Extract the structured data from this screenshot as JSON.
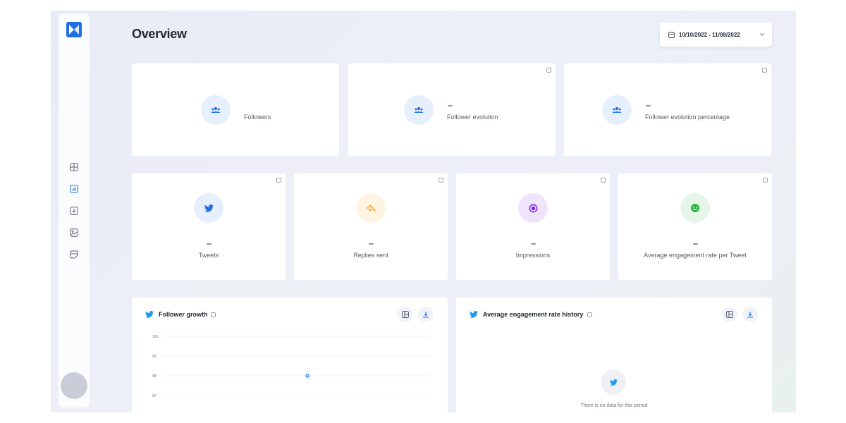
{
  "header": {
    "title": "Overview",
    "date_range": "10/10/2022 - 11/08/2022"
  },
  "sidebar": {
    "items": [
      {
        "icon": "layout-icon"
      },
      {
        "icon": "analytics-icon"
      },
      {
        "icon": "download-icon"
      },
      {
        "icon": "image-icon"
      },
      {
        "icon": "message-icon"
      }
    ]
  },
  "top_stats": [
    {
      "label": "Followers",
      "value": "",
      "icon": "users-icon"
    },
    {
      "label": "Follower evolution",
      "value": "–",
      "icon": "users-icon"
    },
    {
      "label": "Follower evolution percentage",
      "value": "–",
      "icon": "users-icon"
    }
  ],
  "metric_cards": [
    {
      "label": "Tweets",
      "value": "–",
      "icon": "twitter-icon",
      "color": "#1d9bf0"
    },
    {
      "label": "Replies sent",
      "value": "–",
      "icon": "reply-icon",
      "color": "#f5a623"
    },
    {
      "label": "Impressions",
      "value": "–",
      "icon": "target-icon",
      "color": "#7b22e8"
    },
    {
      "label": "Average engagement rate per Tweet",
      "value": "–",
      "icon": "smile-icon",
      "color": "#2fb344"
    }
  ],
  "follower_growth": {
    "title": "Follower growth",
    "chart_data": {
      "type": "scatter",
      "y_ticks": [
        "100",
        "99",
        "98",
        "97"
      ],
      "series": [
        {
          "values": [
            98
          ]
        }
      ]
    }
  },
  "engagement_history": {
    "title": "Average engagement rate history",
    "empty_text": "There is no data for this period"
  },
  "colors": {
    "twitter_blue": "#1d9bf0",
    "accent_blue": "#1f6fe0"
  }
}
